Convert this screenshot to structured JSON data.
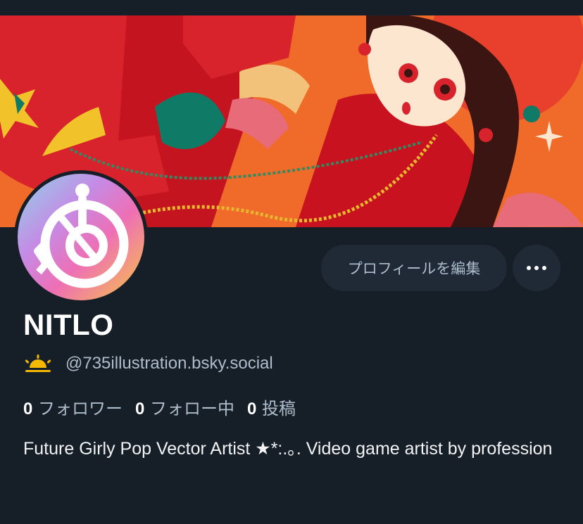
{
  "profile": {
    "display_name": "NITLO",
    "handle": "@735illustration.bsky.social",
    "bio": "Future Girly Pop Vector Artist ★*:.｡. Video game artist by profession",
    "stats": {
      "followers_count": "0",
      "followers_label": "フォロワー",
      "following_count": "0",
      "following_label": "フォロー中",
      "posts_count": "0",
      "posts_label": "投稿"
    }
  },
  "actions": {
    "edit_profile_label": "プロフィールを編集",
    "more_icon": "ellipsis-icon"
  },
  "icons": {
    "handle_icon": "sunrise-icon"
  },
  "colors": {
    "background": "#161e27",
    "button_bg": "#1f2a36",
    "muted_text": "#aebdcc",
    "banner_red": "#d8232c",
    "banner_orange": "#f06a2a",
    "sunrise_yellow": "#f5b800"
  }
}
